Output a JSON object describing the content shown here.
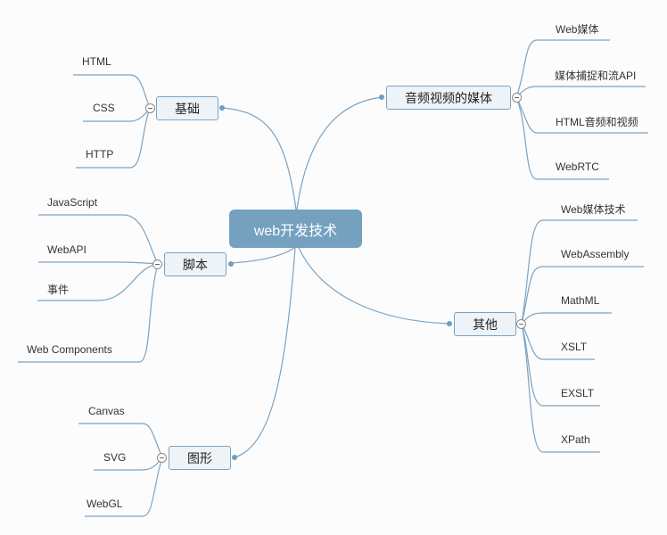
{
  "mindmap": {
    "root": {
      "label": "web开发技术"
    },
    "branches": [
      {
        "label": "基础",
        "children": [
          "HTML",
          "CSS",
          "HTTP"
        ]
      },
      {
        "label": "脚本",
        "children": [
          "JavaScript",
          "WebAPI",
          "事件",
          "Web Components"
        ]
      },
      {
        "label": "图形",
        "children": [
          "Canvas",
          "SVG",
          "WebGL"
        ]
      },
      {
        "label": "音频视频的媒体",
        "children": [
          "Web媒体",
          "媒体捕捉和流API",
          "HTML音频和视频",
          "WebRTC"
        ]
      },
      {
        "label": "其他",
        "children": [
          "Web媒体技术",
          "WebAssembly",
          "MathML",
          "XSLT",
          "EXSLT",
          "XPath"
        ]
      }
    ],
    "colors": {
      "line": "#7ba3c1",
      "root_fill": "#73a1bf",
      "branch_fill": "#eef3f7",
      "branch_border": "#7ba3c1",
      "background": "#fcfcfd"
    },
    "toggle_icon": "collapse-minus-icon"
  }
}
